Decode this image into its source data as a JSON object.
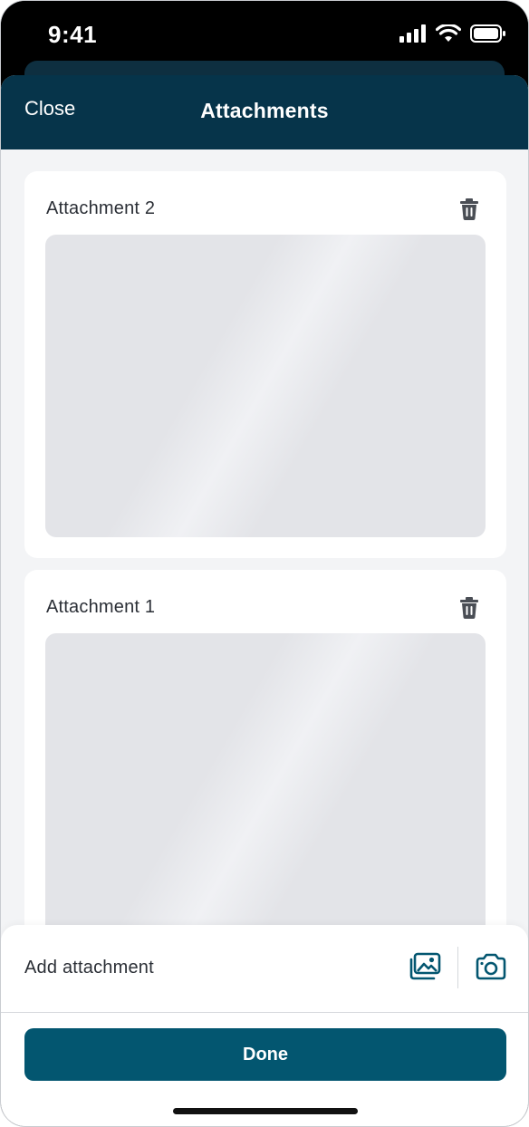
{
  "status_bar": {
    "time": "9:41"
  },
  "nav": {
    "close_label": "Close",
    "title": "Attachments"
  },
  "attachments": [
    {
      "title": "Attachment 2"
    },
    {
      "title": "Attachment 1"
    }
  ],
  "bottom_bar": {
    "add_label": "Add attachment",
    "done_label": "Done"
  },
  "icons": {
    "delete": "trash-icon",
    "gallery": "image-gallery-icon",
    "camera": "camera-icon"
  },
  "colors": {
    "header": "#06344a",
    "primary_button": "#035670",
    "icon_teal": "#035670",
    "background": "#f3f4f6"
  }
}
